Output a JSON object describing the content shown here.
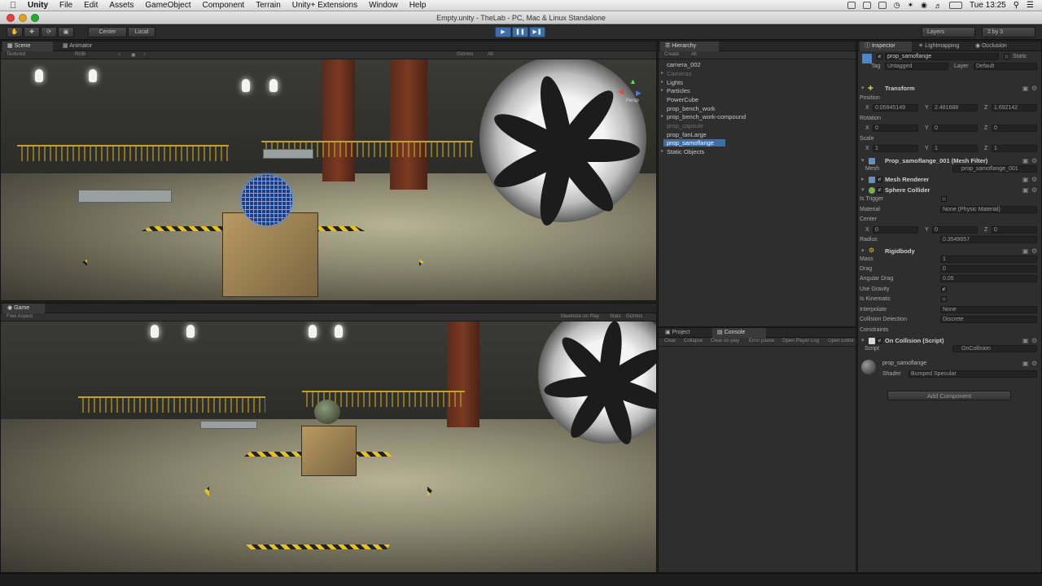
{
  "menubar": {
    "apple_icon": "apple-icon",
    "items": [
      "Unity",
      "File",
      "Edit",
      "Assets",
      "GameObject",
      "Component",
      "Terrain",
      "Unity+ Extensions",
      "Window",
      "Help"
    ],
    "clock": "Tue 13:25"
  },
  "window": {
    "title": "Empty.unity - TheLab - PC, Mac & Linux Standalone"
  },
  "toolbar": {
    "pivot": "Center",
    "space": "Local",
    "layers": "Layers",
    "layout": "2 by 3"
  },
  "scene": {
    "tabs": [
      "Scene",
      "Animator"
    ],
    "render_mode": "Textured",
    "color_mode": "RGB",
    "gizmos": "Gizmos",
    "search": "All",
    "persp": "Persp"
  },
  "game": {
    "tab": "Game",
    "aspect": "Free Aspect",
    "maximize": "Maximize on Play",
    "stats": "Stats",
    "gizmos": "Gizmos"
  },
  "hierarchy": {
    "tab": "Hierarchy",
    "create": "Create",
    "search": "All",
    "items": [
      {
        "label": "camera_002",
        "dim": false,
        "fold": false
      },
      {
        "label": "Cameras",
        "dim": true,
        "fold": true
      },
      {
        "label": "Lights",
        "dim": false,
        "fold": true
      },
      {
        "label": "Particles",
        "dim": false,
        "fold": true
      },
      {
        "label": "PowerCube",
        "dim": false,
        "fold": false
      },
      {
        "label": "prop_bench_work",
        "dim": false,
        "fold": false
      },
      {
        "label": "prop_bench_work-compound",
        "dim": false,
        "fold": true
      },
      {
        "label": "prop_capsule",
        "dim": true,
        "fold": false
      },
      {
        "label": "prop_fanLarge",
        "dim": false,
        "fold": false
      },
      {
        "label": "prop_samoflange",
        "dim": false,
        "fold": false
      },
      {
        "label": "Static Objects",
        "dim": false,
        "fold": true
      }
    ]
  },
  "project_console": {
    "tabs": [
      "Project",
      "Console"
    ],
    "buttons": [
      "Clear",
      "Collapse",
      "Clear on play",
      "Error pause",
      "Open Player Log",
      "Open Editor Log"
    ]
  },
  "inspector": {
    "tabs": [
      "Inspector",
      "Lightmapping",
      "Occlusion"
    ],
    "object_name": "prop_samoflange",
    "static": "Static",
    "tag_label": "Tag",
    "tag_value": "Untagged",
    "layer_label": "Layer",
    "layer_value": "Default",
    "transform": {
      "title": "Transform",
      "position_label": "Position",
      "position": {
        "x": "0.05945149",
        "y": "2.481688",
        "z": "1.692142"
      },
      "rotation_label": "Rotation",
      "rotation": {
        "x": "0",
        "y": "0",
        "z": "0"
      },
      "scale_label": "Scale",
      "scale": {
        "x": "1",
        "y": "1",
        "z": "1"
      }
    },
    "mesh_filter": {
      "title": "Prop_samoflange_001 (Mesh Filter)",
      "mesh_label": "Mesh",
      "mesh_value": "prop_samoflange_001"
    },
    "mesh_renderer": {
      "title": "Mesh Renderer"
    },
    "sphere_collider": {
      "title": "Sphere Collider",
      "is_trigger": "Is Trigger",
      "material_label": "Material",
      "material_value": "None (Physic Material)",
      "center_label": "Center",
      "center": {
        "x": "0",
        "y": "0",
        "z": "0"
      },
      "radius_label": "Radius",
      "radius": "0.3549657"
    },
    "rigidbody": {
      "title": "Rigidbody",
      "mass_label": "Mass",
      "mass": "1",
      "drag_label": "Drag",
      "drag": "0",
      "angular_drag_label": "Angular Drag",
      "angular_drag": "0.05",
      "use_gravity": "Use Gravity",
      "is_kinematic": "Is Kinematic",
      "interpolate_label": "Interpolate",
      "interpolate": "None",
      "collision_label": "Collision Detection",
      "collision": "Discrete",
      "constraints": "Constraints"
    },
    "script": {
      "title": "On Collision (Script)",
      "script_label": "Script",
      "script_value": "OnCollision"
    },
    "material": {
      "name": "prop_samoflange",
      "shader_label": "Shader",
      "shader_value": "Bumped Specular"
    },
    "add_component": "Add Component"
  },
  "colors": {
    "accent": "#3d6ea8",
    "hazard": "#e3c12b",
    "panel": "#2e2e2e"
  }
}
